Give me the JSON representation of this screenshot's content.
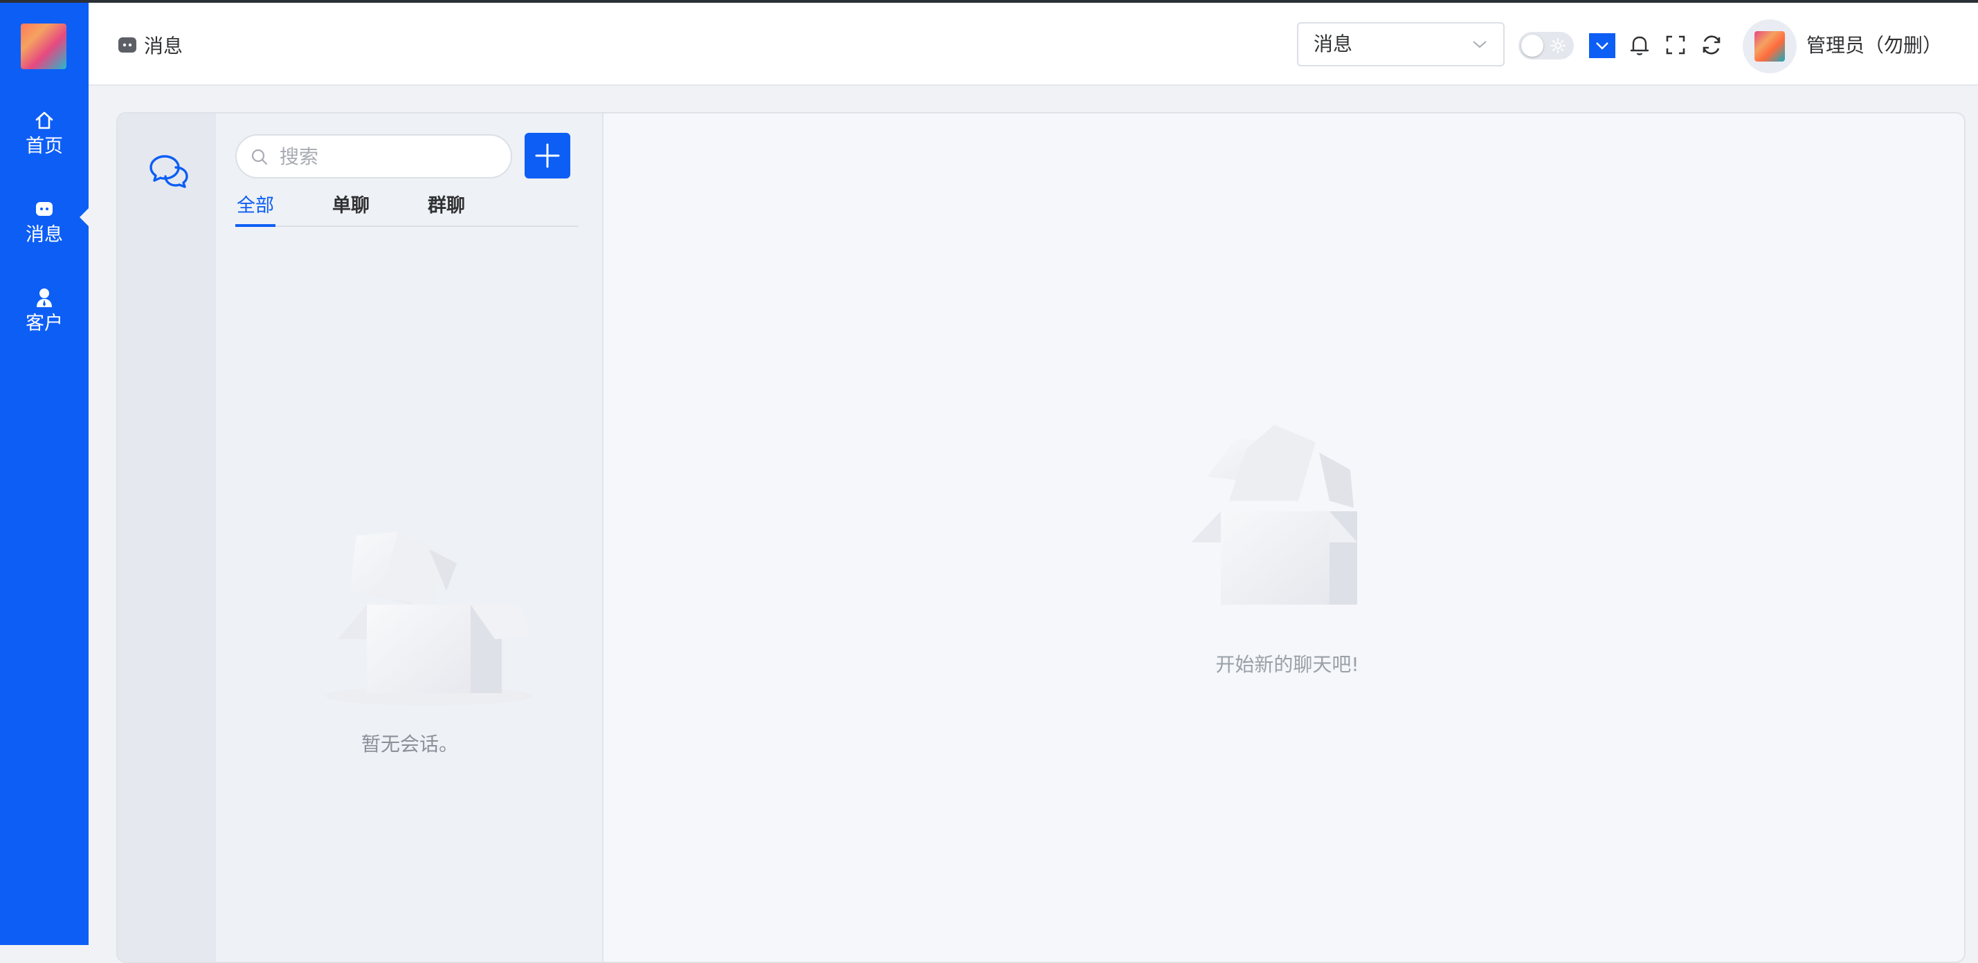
{
  "sidebar": {
    "items": [
      {
        "label": "首页",
        "icon": "home-icon"
      },
      {
        "label": "消息",
        "icon": "message-icon",
        "active": true
      },
      {
        "label": "客户",
        "icon": "customer-icon"
      }
    ]
  },
  "header": {
    "breadcrumb": "消息",
    "select_value": "消息",
    "user_name": "管理员（勿删）"
  },
  "chat": {
    "search_placeholder": "搜索",
    "tabs": [
      {
        "label": "全部",
        "active": true
      },
      {
        "label": "单聊"
      },
      {
        "label": "群聊"
      }
    ],
    "empty_list_text": "暂无会话。",
    "empty_chat_text": "开始新的聊天吧!"
  },
  "colors": {
    "accent": "#0d5ef5",
    "sidebar_bg": "#0d5ef5",
    "page_bg": "#f0f2f5"
  }
}
